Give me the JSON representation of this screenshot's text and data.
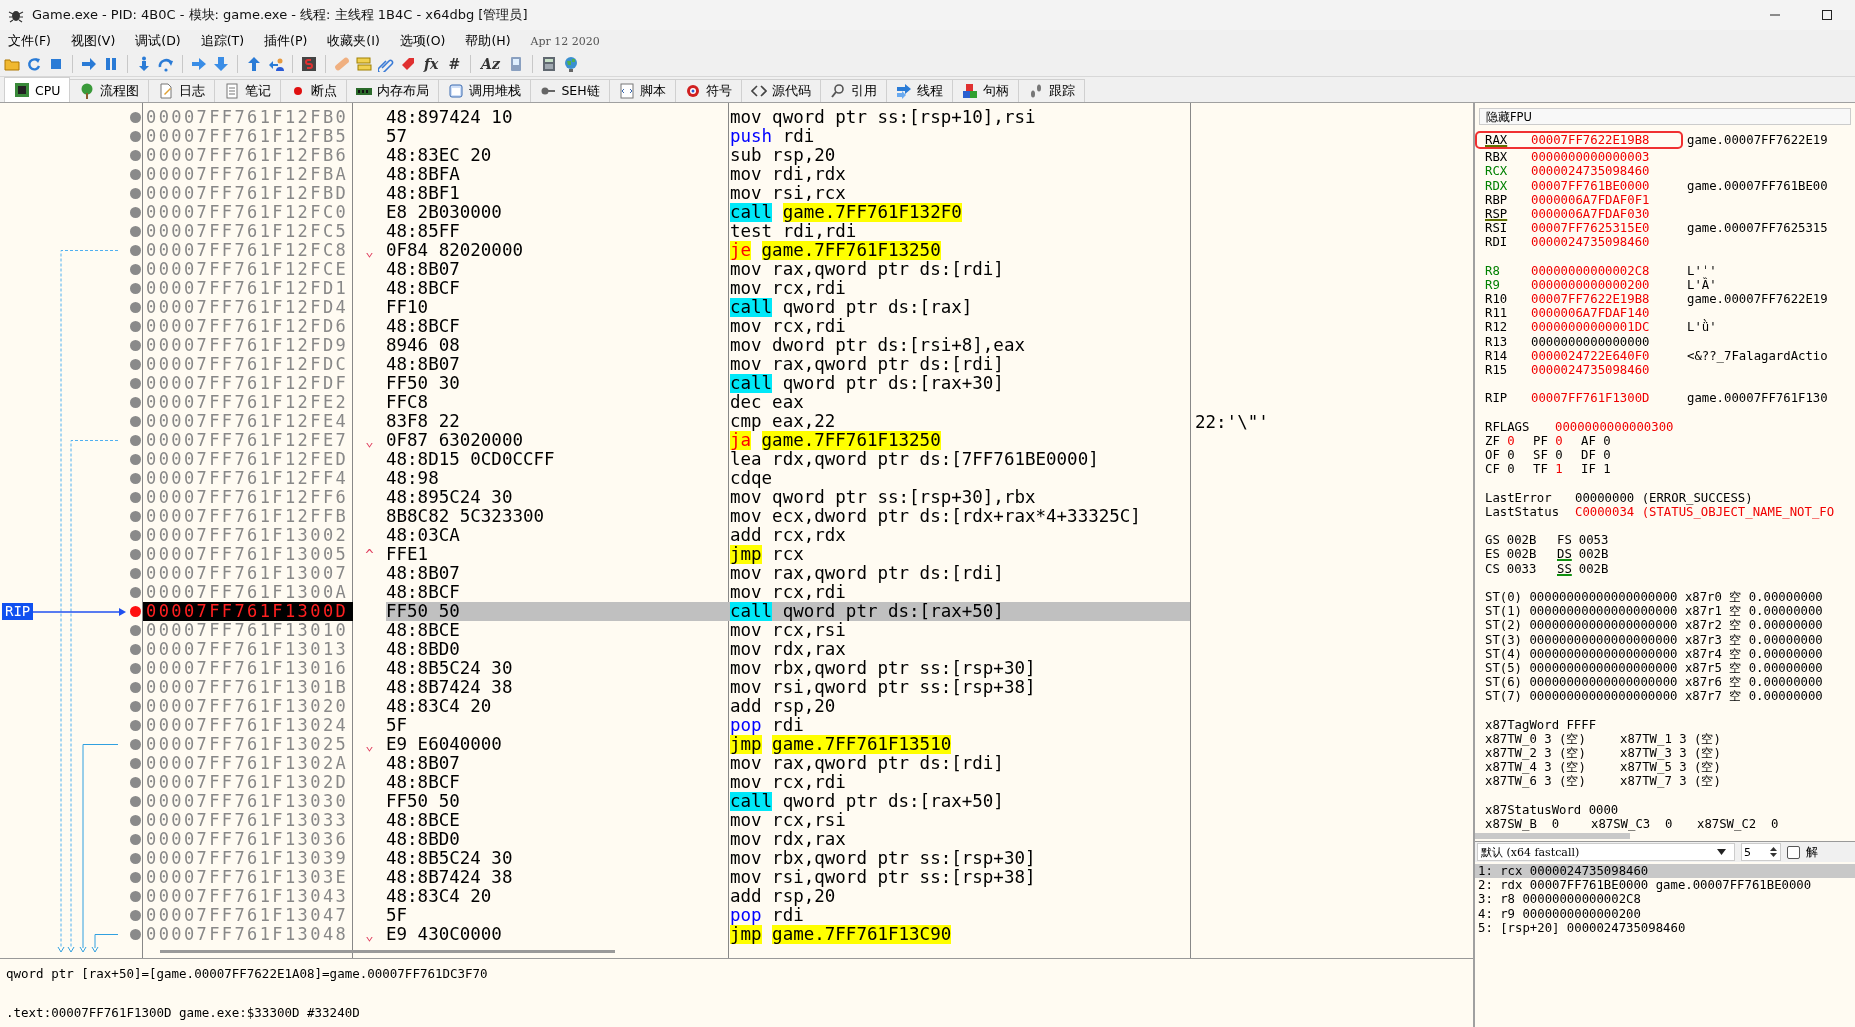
{
  "window": {
    "title": "Game.exe - PID: 4B0C - 模块: game.exe - 线程: 主线程 1B4C - x64dbg [管理员]"
  },
  "menu": [
    "文件(F)",
    "视图(V)",
    "调试(D)",
    "追踪(T)",
    "插件(P)",
    "收藏夹(I)",
    "选项(O)",
    "帮助(H)"
  ],
  "build_date": "Apr 12 2020",
  "toolbar": [
    {
      "kind": "icon"
    },
    {
      "kind": "icon"
    },
    {
      "kind": "icon"
    },
    {
      "kind": "separator"
    },
    {
      "kind": "icon"
    },
    {
      "kind": "icon"
    },
    {
      "kind": "separator"
    },
    {
      "kind": "icon"
    },
    {
      "kind": "icon"
    },
    {
      "kind": "separator"
    },
    {
      "kind": "icon"
    },
    {
      "kind": "icon"
    },
    {
      "kind": "separator"
    },
    {
      "kind": "icon"
    },
    {
      "kind": "icon"
    },
    {
      "kind": "separator"
    },
    {
      "kind": "icon"
    },
    {
      "kind": "separator"
    },
    {
      "kind": "icon"
    },
    {
      "kind": "icon"
    },
    {
      "kind": "icon"
    },
    {
      "kind": "icon"
    },
    {
      "kind": "glyph",
      "label": "fx"
    },
    {
      "kind": "glyph",
      "label": "#"
    },
    {
      "kind": "separator"
    },
    {
      "kind": "glyph",
      "label": "Aᴢ"
    },
    {
      "kind": "icon"
    },
    {
      "kind": "separator"
    },
    {
      "kind": "icon"
    },
    {
      "kind": "icon"
    }
  ],
  "tabs": [
    {
      "label": "CPU",
      "selected": true
    },
    {
      "label": "流程图",
      "selected": false
    },
    {
      "label": "日志",
      "selected": false
    },
    {
      "label": "笔记",
      "selected": false
    },
    {
      "label": "断点",
      "selected": false
    },
    {
      "label": "内存布局",
      "selected": false
    },
    {
      "label": "调用堆栈",
      "selected": false
    },
    {
      "label": "SEH链",
      "selected": false
    },
    {
      "label": "脚本",
      "selected": false
    },
    {
      "label": "符号",
      "selected": false
    },
    {
      "label": "源代码",
      "selected": false
    },
    {
      "label": "引用",
      "selected": false
    },
    {
      "label": "线程",
      "selected": false
    },
    {
      "label": "句柄",
      "selected": false
    },
    {
      "label": "跟踪",
      "selected": false
    }
  ],
  "disassembly": {
    "rip_label": "RIP",
    "rows": [
      {
        "address": "00007FF761F12FB0",
        "bytes": "48:897424 10",
        "mnemonic": "mov",
        "operands": "qword ptr ss:[rsp+10],rsi",
        "kind": "normal",
        "direct": false,
        "breakpoint": false,
        "selected": false
      },
      {
        "address": "00007FF761F12FB5",
        "bytes": "57",
        "mnemonic": "push",
        "operands": "rdi",
        "kind": "stack",
        "direct": false,
        "breakpoint": false,
        "selected": false
      },
      {
        "address": "00007FF761F12FB6",
        "bytes": "48:83EC 20",
        "mnemonic": "sub",
        "operands": "rsp,20",
        "kind": "normal",
        "direct": false,
        "breakpoint": false,
        "selected": false
      },
      {
        "address": "00007FF761F12FBA",
        "bytes": "48:8BFA",
        "mnemonic": "mov",
        "operands": "rdi,rdx",
        "kind": "normal",
        "direct": false,
        "breakpoint": false,
        "selected": false
      },
      {
        "address": "00007FF761F12FBD",
        "bytes": "48:8BF1",
        "mnemonic": "mov",
        "operands": "rsi,rcx",
        "kind": "normal",
        "direct": false,
        "breakpoint": false,
        "selected": false
      },
      {
        "address": "00007FF761F12FC0",
        "bytes": "E8 2B030000",
        "mnemonic": "call",
        "operands": "game.7FF761F132F0",
        "kind": "call",
        "direct": true,
        "breakpoint": false,
        "selected": false
      },
      {
        "address": "00007FF761F12FC5",
        "bytes": "48:85FF",
        "mnemonic": "test",
        "operands": "rdi,rdi",
        "kind": "normal",
        "direct": false,
        "breakpoint": false,
        "selected": false
      },
      {
        "address": "00007FF761F12FC8",
        "marker": "⌄",
        "bytes": "0F84 82020000",
        "mnemonic": "je",
        "operands": "game.7FF761F13250",
        "kind": "jcc",
        "direct": true,
        "breakpoint": false,
        "selected": false
      },
      {
        "address": "00007FF761F12FCE",
        "bytes": "48:8B07",
        "mnemonic": "mov",
        "operands": "rax,qword ptr ds:[rdi]",
        "kind": "normal",
        "direct": false,
        "breakpoint": false,
        "selected": false
      },
      {
        "address": "00007FF761F12FD1",
        "bytes": "48:8BCF",
        "mnemonic": "mov",
        "operands": "rcx,rdi",
        "kind": "normal",
        "direct": false,
        "breakpoint": false,
        "selected": false
      },
      {
        "address": "00007FF761F12FD4",
        "bytes": "FF10",
        "mnemonic": "call",
        "operands": "qword ptr ds:[rax]",
        "kind": "call",
        "direct": false,
        "breakpoint": false,
        "selected": false
      },
      {
        "address": "00007FF761F12FD6",
        "bytes": "48:8BCF",
        "mnemonic": "mov",
        "operands": "rcx,rdi",
        "kind": "normal",
        "direct": false,
        "breakpoint": false,
        "selected": false
      },
      {
        "address": "00007FF761F12FD9",
        "bytes": "8946 08",
        "mnemonic": "mov",
        "operands": "dword ptr ds:[rsi+8],eax",
        "kind": "normal",
        "direct": false,
        "breakpoint": false,
        "selected": false
      },
      {
        "address": "00007FF761F12FDC",
        "bytes": "48:8B07",
        "mnemonic": "mov",
        "operands": "rax,qword ptr ds:[rdi]",
        "kind": "normal",
        "direct": false,
        "breakpoint": false,
        "selected": false
      },
      {
        "address": "00007FF761F12FDF",
        "bytes": "FF50 30",
        "mnemonic": "call",
        "operands": "qword ptr ds:[rax+30]",
        "kind": "call",
        "direct": false,
        "breakpoint": false,
        "selected": false
      },
      {
        "address": "00007FF761F12FE2",
        "bytes": "FFC8",
        "mnemonic": "dec",
        "operands": "eax",
        "kind": "normal",
        "direct": false,
        "breakpoint": false,
        "selected": false
      },
      {
        "address": "00007FF761F12FE4",
        "bytes": "83F8 22",
        "mnemonic": "cmp",
        "operands": "eax,22",
        "kind": "normal",
        "direct": false,
        "comment": "22:'\\\"'",
        "breakpoint": false,
        "selected": false
      },
      {
        "address": "00007FF761F12FE7",
        "marker": "⌄",
        "bytes": "0F87 63020000",
        "mnemonic": "ja",
        "operands": "game.7FF761F13250",
        "kind": "jcc",
        "direct": true,
        "breakpoint": false,
        "selected": false
      },
      {
        "address": "00007FF761F12FED",
        "bytes": "48:8D15 0CD0CCFF",
        "mnemonic": "lea",
        "operands": "rdx,qword ptr ds:[7FF761BE0000]",
        "kind": "normal",
        "direct": false,
        "breakpoint": false,
        "selected": false
      },
      {
        "address": "00007FF761F12FF4",
        "bytes": "48:98",
        "mnemonic": "cdqe",
        "kind": "normal",
        "breakpoint": false,
        "selected": false
      },
      {
        "address": "00007FF761F12FF6",
        "bytes": "48:895C24 30",
        "mnemonic": "mov",
        "operands": "qword ptr ss:[rsp+30],rbx",
        "kind": "normal",
        "direct": false,
        "breakpoint": false,
        "selected": false
      },
      {
        "address": "00007FF761F12FFB",
        "bytes": "8B8C82 5C323300",
        "mnemonic": "mov",
        "operands": "ecx,dword ptr ds:[rdx+rax*4+33325C]",
        "kind": "normal",
        "direct": false,
        "breakpoint": false,
        "selected": false
      },
      {
        "address": "00007FF761F13002",
        "bytes": "48:03CA",
        "mnemonic": "add",
        "operands": "rcx,rdx",
        "kind": "normal",
        "direct": false,
        "breakpoint": false,
        "selected": false
      },
      {
        "address": "00007FF761F13005",
        "marker": "^",
        "bytes": "FFE1",
        "mnemonic": "jmp",
        "operands": "rcx",
        "kind": "jmp",
        "direct": false,
        "breakpoint": false,
        "selected": false
      },
      {
        "address": "00007FF761F13007",
        "bytes": "48:8B07",
        "mnemonic": "mov",
        "operands": "rax,qword ptr ds:[rdi]",
        "kind": "normal",
        "direct": false,
        "breakpoint": false,
        "selected": false
      },
      {
        "address": "00007FF761F1300A",
        "bytes": "48:8BCF",
        "mnemonic": "mov",
        "operands": "rcx,rdi",
        "kind": "normal",
        "direct": false,
        "breakpoint": false,
        "selected": false
      },
      {
        "address": "00007FF761F1300D",
        "bytes": "FF50 50",
        "mnemonic": "call",
        "operands": "qword ptr ds:[rax+50]",
        "kind": "call",
        "direct": false,
        "breakpoint": true,
        "selected": true
      },
      {
        "address": "00007FF761F13010",
        "bytes": "48:8BCE",
        "mnemonic": "mov",
        "operands": "rcx,rsi",
        "kind": "normal",
        "direct": false,
        "breakpoint": false,
        "selected": false
      },
      {
        "address": "00007FF761F13013",
        "bytes": "48:8BD0",
        "mnemonic": "mov",
        "operands": "rdx,rax",
        "kind": "normal",
        "direct": false,
        "breakpoint": false,
        "selected": false
      },
      {
        "address": "00007FF761F13016",
        "bytes": "48:8B5C24 30",
        "mnemonic": "mov",
        "operands": "rbx,qword ptr ss:[rsp+30]",
        "kind": "normal",
        "direct": false,
        "breakpoint": false,
        "selected": false
      },
      {
        "address": "00007FF761F1301B",
        "bytes": "48:8B7424 38",
        "mnemonic": "mov",
        "operands": "rsi,qword ptr ss:[rsp+38]",
        "kind": "normal",
        "direct": false,
        "breakpoint": false,
        "selected": false
      },
      {
        "address": "00007FF761F13020",
        "bytes": "48:83C4 20",
        "mnemonic": "add",
        "operands": "rsp,20",
        "kind": "normal",
        "direct": false,
        "breakpoint": false,
        "selected": false
      },
      {
        "address": "00007FF761F13024",
        "bytes": "5F",
        "mnemonic": "pop",
        "operands": "rdi",
        "kind": "stack",
        "direct": false,
        "breakpoint": false,
        "selected": false
      },
      {
        "address": "00007FF761F13025",
        "marker": "⌄",
        "bytes": "E9 E6040000",
        "mnemonic": "jmp",
        "operands": "game.7FF761F13510",
        "kind": "jmp",
        "direct": true,
        "breakpoint": false,
        "selected": false
      },
      {
        "address": "00007FF761F1302A",
        "bytes": "48:8B07",
        "mnemonic": "mov",
        "operands": "rax,qword ptr ds:[rdi]",
        "kind": "normal",
        "direct": false,
        "breakpoint": false,
        "selected": false
      },
      {
        "address": "00007FF761F1302D",
        "bytes": "48:8BCF",
        "mnemonic": "mov",
        "operands": "rcx,rdi",
        "kind": "normal",
        "direct": false,
        "breakpoint": false,
        "selected": false
      },
      {
        "address": "00007FF761F13030",
        "bytes": "FF50 50",
        "mnemonic": "call",
        "operands": "qword ptr ds:[rax+50]",
        "kind": "call",
        "direct": false,
        "breakpoint": false,
        "selected": false
      },
      {
        "address": "00007FF761F13033",
        "bytes": "48:8BCE",
        "mnemonic": "mov",
        "operands": "rcx,rsi",
        "kind": "normal",
        "direct": false,
        "breakpoint": false,
        "selected": false
      },
      {
        "address": "00007FF761F13036",
        "bytes": "48:8BD0",
        "mnemonic": "mov",
        "operands": "rdx,rax",
        "kind": "normal",
        "direct": false,
        "breakpoint": false,
        "selected": false
      },
      {
        "address": "00007FF761F13039",
        "bytes": "48:8B5C24 30",
        "mnemonic": "mov",
        "operands": "rbx,qword ptr ss:[rsp+30]",
        "kind": "normal",
        "direct": false,
        "breakpoint": false,
        "selected": false
      },
      {
        "address": "00007FF761F1303E",
        "bytes": "48:8B7424 38",
        "mnemonic": "mov",
        "operands": "rsi,qword ptr ss:[rsp+38]",
        "kind": "normal",
        "direct": false,
        "breakpoint": false,
        "selected": false
      },
      {
        "address": "00007FF761F13043",
        "bytes": "48:83C4 20",
        "mnemonic": "add",
        "operands": "rsp,20",
        "kind": "normal",
        "direct": false,
        "breakpoint": false,
        "selected": false
      },
      {
        "address": "00007FF761F13047",
        "bytes": "5F",
        "mnemonic": "pop",
        "operands": "rdi",
        "kind": "stack",
        "direct": false,
        "breakpoint": false,
        "selected": false
      },
      {
        "address": "00007FF761F13048",
        "marker": "⌄",
        "bytes": "E9 430C0000",
        "mnemonic": "jmp",
        "operands": "game.7FF761F13C90",
        "kind": "jmp",
        "direct": true,
        "breakpoint": false,
        "selected": false
      }
    ]
  },
  "info_panel": [
    "qword ptr [rax+50]=[game.00007FF7622E1A08]=game.00007FF761DC3F70",
    ".text:00007FF761F1300D game.exe:$33300D #33240D"
  ],
  "registers_panel": {
    "fpu_button": "隐藏FPU",
    "register_groups": [
      [
        {
          "name": "RAX",
          "value": "00007FF7622E19B8",
          "comment": "game.00007FF7622E19",
          "changed": true,
          "argument": false,
          "underlined": true,
          "boxed": true
        },
        {
          "name": "RBX",
          "value": "0000000000000003",
          "changed": true,
          "argument": false,
          "underlined": false,
          "boxed": false
        },
        {
          "name": "RCX",
          "value": "0000024735098460",
          "changed": true,
          "argument": true,
          "underlined": false,
          "boxed": false
        },
        {
          "name": "RDX",
          "value": "00007FF761BE0000",
          "comment": "game.00007FF761BE00",
          "changed": true,
          "argument": true,
          "underlined": false,
          "boxed": false
        },
        {
          "name": "RBP",
          "value": "0000006A7FDAF0F1",
          "changed": true,
          "argument": false,
          "underlined": false,
          "boxed": false
        },
        {
          "name": "RSP",
          "value": "0000006A7FDAF030",
          "changed": true,
          "argument": false,
          "underlined": true,
          "boxed": false
        },
        {
          "name": "RSI",
          "value": "00007FF7625315E0",
          "comment": "game.00007FF7625315",
          "changed": true,
          "argument": false,
          "underlined": false,
          "boxed": false
        },
        {
          "name": "RDI",
          "value": "0000024735098460",
          "changed": true,
          "argument": false,
          "underlined": false,
          "boxed": false
        }
      ],
      [
        {
          "name": "R8",
          "value": "00000000000002C8",
          "comment": "L'ˈ'",
          "changed": true,
          "argument": true,
          "underlined": false,
          "boxed": false
        },
        {
          "name": "R9",
          "value": "0000000000000200",
          "comment": "L'Ȁ'",
          "changed": true,
          "argument": true,
          "underlined": false,
          "boxed": false
        },
        {
          "name": "R10",
          "value": "00007FF7622E19B8",
          "comment": "game.00007FF7622E19",
          "changed": true,
          "argument": false,
          "underlined": false,
          "boxed": false
        },
        {
          "name": "R11",
          "value": "0000006A7FDAF140",
          "changed": true,
          "argument": false,
          "underlined": false,
          "boxed": false
        },
        {
          "name": "R12",
          "value": "00000000000001DC",
          "comment": "L'ǜ'",
          "changed": true,
          "argument": false,
          "underlined": false,
          "boxed": false
        },
        {
          "name": "R13",
          "value": "0000000000000000",
          "changed": false,
          "argument": false,
          "underlined": false,
          "boxed": false
        },
        {
          "name": "R14",
          "value": "0000024722E640F0",
          "comment": "<&??_7FalagardActio",
          "changed": true,
          "argument": false,
          "underlined": false,
          "boxed": false
        },
        {
          "name": "R15",
          "value": "0000024735098460",
          "changed": true,
          "argument": false,
          "underlined": false,
          "boxed": false
        }
      ],
      [
        {
          "name": "RIP",
          "value": "00007FF761F1300D",
          "comment": "game.00007FF761F130",
          "changed": true,
          "argument": false,
          "underlined": false,
          "boxed": false
        }
      ]
    ],
    "rflags": {
      "name": "RFLAGS",
      "value": "0000000000000300",
      "changed": true
    },
    "flags": [
      {
        "name": "ZF",
        "value": "0",
        "changed": true
      },
      {
        "name": "PF",
        "value": "0",
        "changed": true
      },
      {
        "name": "AF",
        "value": "0",
        "changed": false
      },
      {
        "name": "OF",
        "value": "0",
        "changed": false
      },
      {
        "name": "SF",
        "value": "0",
        "changed": false
      },
      {
        "name": "DF",
        "value": "0",
        "changed": false
      },
      {
        "name": "CF",
        "value": "0",
        "changed": false
      },
      {
        "name": "TF",
        "value": "1",
        "changed": true
      },
      {
        "name": "IF",
        "value": "1",
        "changed": false
      }
    ],
    "errors": [
      {
        "name": "LastError",
        "code": "00000000",
        "text": "(ERROR_SUCCESS)",
        "changed": false
      },
      {
        "name": "LastStatus",
        "code": "C0000034",
        "text": "(STATUS_OBJECT_NAME_NOT_FO",
        "changed": true
      }
    ],
    "segments": [
      {
        "name": "GS",
        "value": "002B",
        "underlined": false
      },
      {
        "name": "FS",
        "value": "0053",
        "underlined": false
      },
      {
        "name": "ES",
        "value": "002B",
        "underlined": false
      },
      {
        "name": "DS",
        "value": "002B",
        "underlined": true
      },
      {
        "name": "CS",
        "value": "0033",
        "underlined": false
      },
      {
        "name": "SS",
        "value": "002B",
        "underlined": true
      }
    ],
    "fpu": [
      {
        "name": "ST(0)",
        "value": "00000000000000000000",
        "reg": "x87r0",
        "tag": "空",
        "float": "0.00000000"
      },
      {
        "name": "ST(1)",
        "value": "00000000000000000000",
        "reg": "x87r1",
        "tag": "空",
        "float": "0.00000000"
      },
      {
        "name": "ST(2)",
        "value": "00000000000000000000",
        "reg": "x87r2",
        "tag": "空",
        "float": "0.00000000"
      },
      {
        "name": "ST(3)",
        "value": "00000000000000000000",
        "reg": "x87r3",
        "tag": "空",
        "float": "0.00000000"
      },
      {
        "name": "ST(4)",
        "value": "00000000000000000000",
        "reg": "x87r4",
        "tag": "空",
        "float": "0.00000000"
      },
      {
        "name": "ST(5)",
        "value": "00000000000000000000",
        "reg": "x87r5",
        "tag": "空",
        "float": "0.00000000"
      },
      {
        "name": "ST(6)",
        "value": "00000000000000000000",
        "reg": "x87r6",
        "tag": "空",
        "float": "0.00000000"
      },
      {
        "name": "ST(7)",
        "value": "00000000000000000000",
        "reg": "x87r7",
        "tag": "空",
        "float": "0.00000000"
      }
    ],
    "tag_word": {
      "name": "x87TagWord",
      "value": "FFFF"
    },
    "tag_entries": [
      {
        "name": "x87TW_0",
        "value": "3",
        "tag": "(空)"
      },
      {
        "name": "x87TW_1",
        "value": "3",
        "tag": "(空)"
      },
      {
        "name": "x87TW_2",
        "value": "3",
        "tag": "(空)"
      },
      {
        "name": "x87TW_3",
        "value": "3",
        "tag": "(空)"
      },
      {
        "name": "x87TW_4",
        "value": "3",
        "tag": "(空)"
      },
      {
        "name": "x87TW_5",
        "value": "3",
        "tag": "(空)"
      },
      {
        "name": "x87TW_6",
        "value": "3",
        "tag": "(空)"
      },
      {
        "name": "x87TW_7",
        "value": "3",
        "tag": "(空)"
      }
    ],
    "status_word": {
      "name": "x87StatusWord",
      "value": "0000"
    },
    "status_entries": [
      {
        "name": "x87SW_B",
        "value": "0"
      },
      {
        "name": "x87SW_C3",
        "value": "0"
      },
      {
        "name": "x87SW_C2",
        "value": "0"
      }
    ]
  },
  "call_args": {
    "convention": "默认 (x64 fastcall)",
    "count": "5",
    "lock_label": "解",
    "lock_checked": false,
    "args": [
      {
        "text": "1: rcx 0000024735098460",
        "selected": true
      },
      {
        "text": "2: rdx 00007FF761BE0000 game.00007FF761BE0000",
        "selected": false
      },
      {
        "text": "3: r8 00000000000002C8",
        "selected": false
      },
      {
        "text": "4: r9 0000000000000200",
        "selected": false
      },
      {
        "text": "5: [rsp+20] 0000024735098460",
        "selected": false
      }
    ]
  }
}
